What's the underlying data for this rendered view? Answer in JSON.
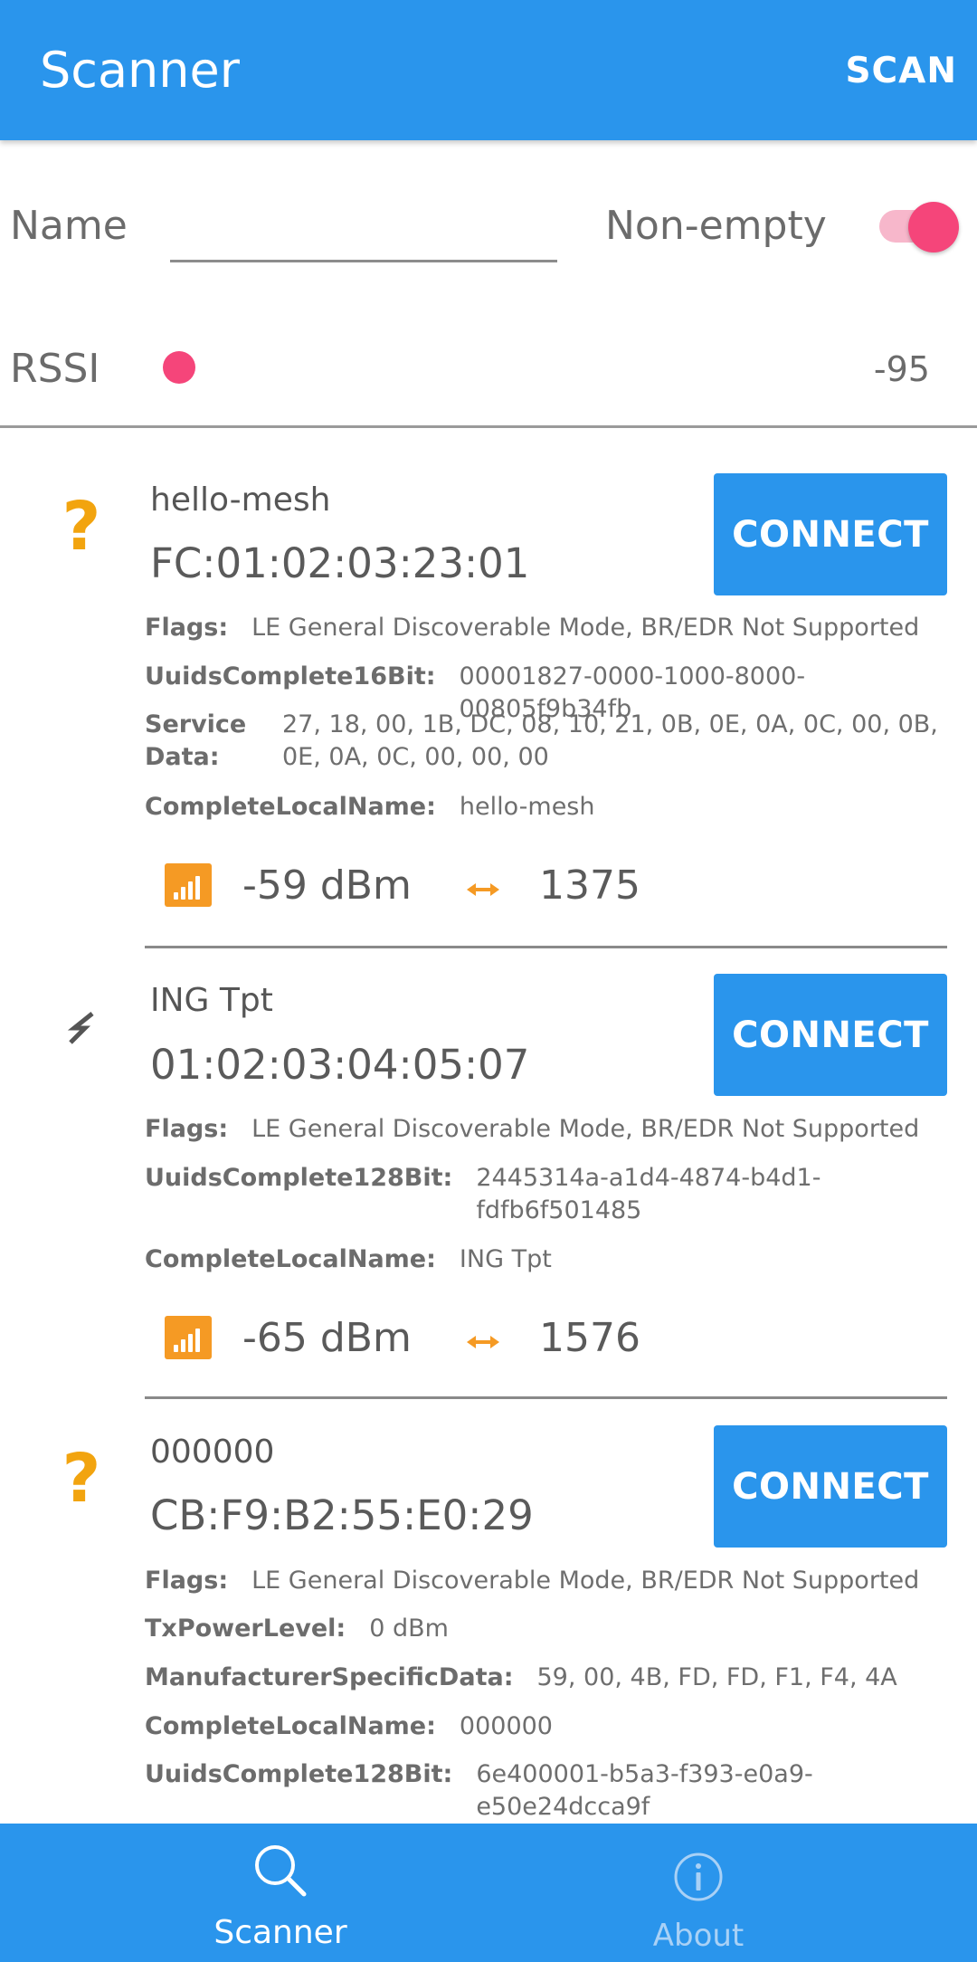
{
  "appbar": {
    "title": "Scanner",
    "action": "SCAN"
  },
  "filters": {
    "name_label": "Name",
    "name_value": "",
    "nonempty_label": "Non-empty",
    "nonempty_on": true,
    "rssi_label": "RSSI",
    "rssi_value": "-95"
  },
  "colors": {
    "primary": "#2a95ec",
    "accent": "#f5457a",
    "icon_orange": "#f2a40f"
  },
  "devices": [
    {
      "icon": "question-mark-icon",
      "icon_glyph": "?",
      "name": "hello-mesh",
      "mac": "FC:01:02:03:23:01",
      "connect": "CONNECT",
      "adv": [
        {
          "key": "Flags:",
          "value": "LE General Discoverable Mode, BR/EDR Not Supported"
        },
        {
          "key": "UuidsComplete16Bit:",
          "value": "00001827-0000-1000-8000-00805f9b34fb"
        },
        {
          "key": "ServiceData:",
          "value": "27, 18, 00, 1B, DC, 08, 10, 21, 0B, 0E, 0A, 0C, 00, 0B, 0E, 0A, 0C, 00, 00, 00"
        },
        {
          "key": "CompleteLocalName:",
          "value": "hello-mesh"
        }
      ],
      "rssi": "-59 dBm",
      "interval": "1375"
    },
    {
      "icon": "bolt-icon",
      "name": "ING Tpt",
      "mac": "01:02:03:04:05:07",
      "connect": "CONNECT",
      "adv": [
        {
          "key": "Flags:",
          "value": "LE General Discoverable Mode, BR/EDR Not Supported"
        },
        {
          "key": "UuidsComplete128Bit:",
          "value": "2445314a-a1d4-4874-b4d1-fdfb6f501485"
        },
        {
          "key": "CompleteLocalName:",
          "value": "ING Tpt"
        }
      ],
      "rssi": "-65 dBm",
      "interval": "1576"
    },
    {
      "icon": "question-mark-icon",
      "icon_glyph": "?",
      "name": "000000",
      "mac": "CB:F9:B2:55:E0:29",
      "connect": "CONNECT",
      "adv": [
        {
          "key": "Flags:",
          "value": "LE General Discoverable Mode, BR/EDR Not Supported"
        },
        {
          "key": "TxPowerLevel:",
          "value": "0 dBm"
        },
        {
          "key": "ManufacturerSpecificData:",
          "value": "59, 00, 4B, FD, FD, F1, F4, 4A"
        },
        {
          "key": "CompleteLocalName:",
          "value": "000000"
        },
        {
          "key": "UuidsComplete128Bit:",
          "value": "6e400001-b5a3-f393-e0a9-e50e24dcca9f"
        }
      ]
    }
  ],
  "nav": {
    "scanner": "Scanner",
    "about": "About"
  }
}
